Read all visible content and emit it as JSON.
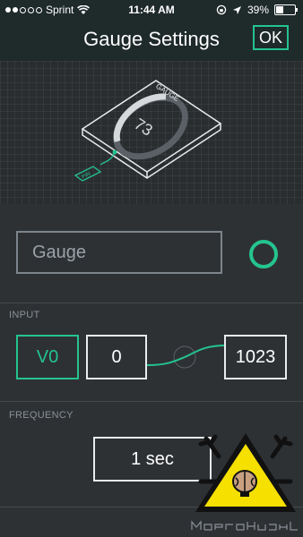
{
  "status_bar": {
    "carrier": "Sprint",
    "time": "11:44 AM",
    "battery": "39%"
  },
  "nav": {
    "title": "Gauge Settings",
    "ok_label": "OK"
  },
  "preview": {
    "widget_label": "GAUGE",
    "gauge_value": "73",
    "pin_label": "PIN"
  },
  "name_input": {
    "value": "Gauge"
  },
  "colors": {
    "accent": "#24c48e",
    "background": "#2e3134",
    "warning": "#f5e000"
  },
  "input_section": {
    "label": "INPUT",
    "pin": "V0",
    "min": "0",
    "max": "1023"
  },
  "frequency_section": {
    "label": "FREQUENCY",
    "value": "1 sec"
  }
}
